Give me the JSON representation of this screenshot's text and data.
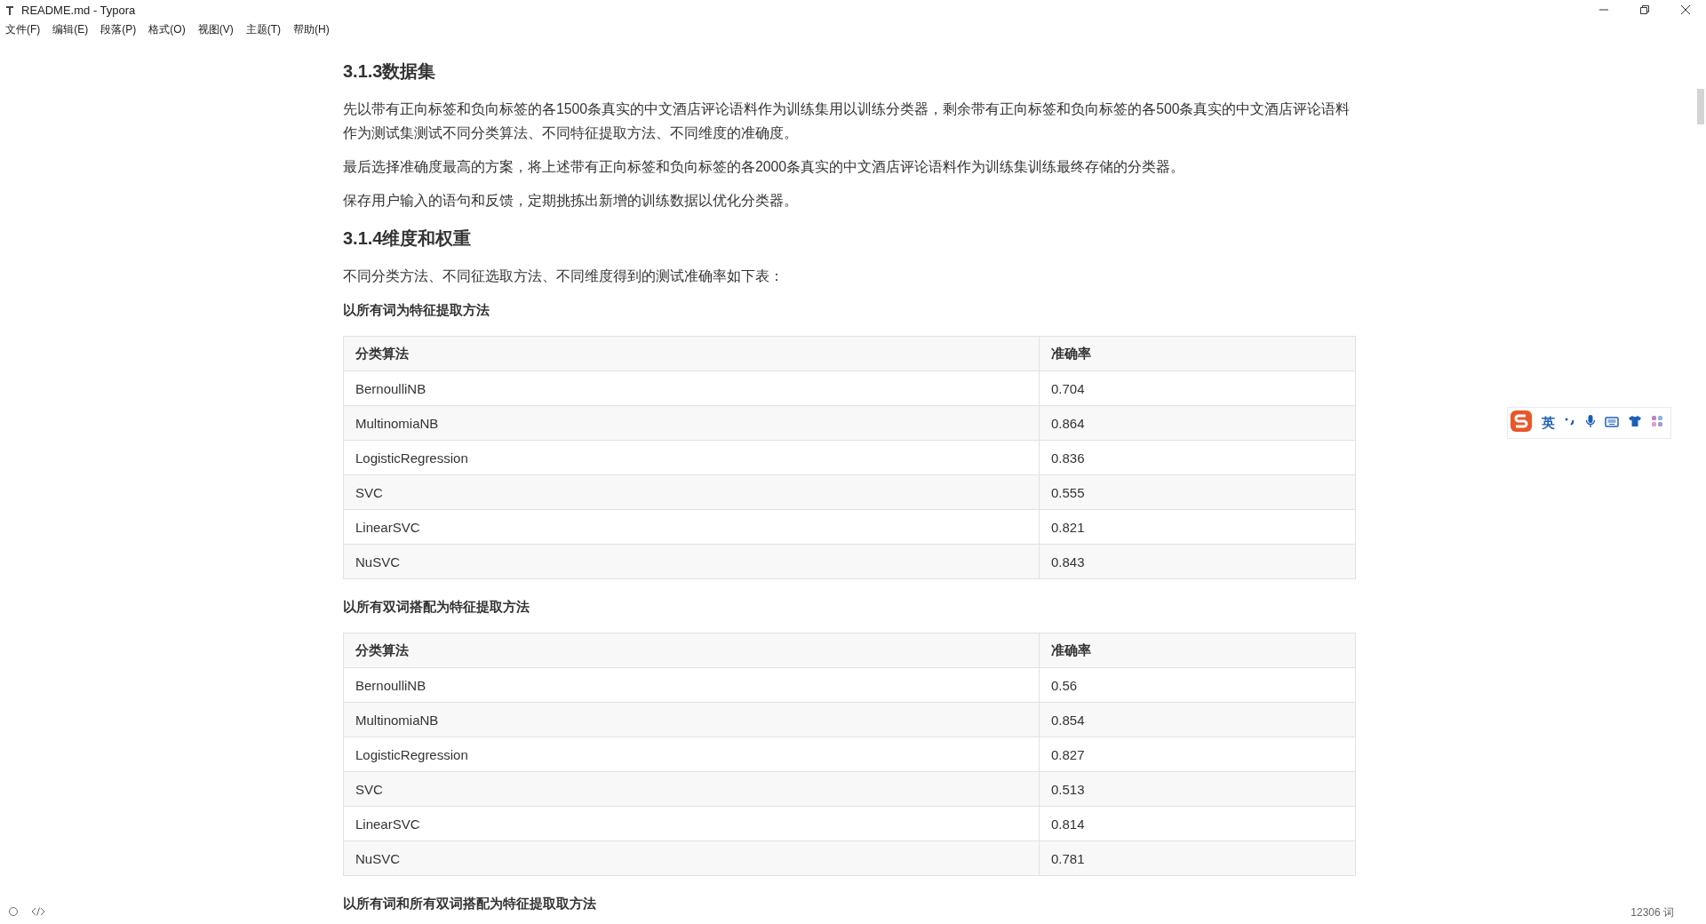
{
  "window": {
    "title": "README.md - Typora"
  },
  "menu": [
    "文件(F)",
    "编辑(E)",
    "段落(P)",
    "格式(O)",
    "视图(V)",
    "主题(T)",
    "帮助(H)"
  ],
  "document": [
    {
      "kind": "heading",
      "text": "3.1.3数据集"
    },
    {
      "kind": "paragraph",
      "text": "先以带有正向标签和负向标签的各1500条真实的中文酒店评论语料作为训练集用以训练分类器，剩余带有正向标签和负向标签的各500条真实的中文酒店评论语料作为测试集测试不同分类算法、不同特征提取方法、不同维度的准确度。"
    },
    {
      "kind": "paragraph",
      "text": "最后选择准确度最高的方案，将上述带有正向标签和负向标签的各2000条真实的中文酒店评论语料作为训练集训练最终存储的分类器。"
    },
    {
      "kind": "paragraph",
      "text": "保存用户输入的语句和反馈，定期挑拣出新增的训练数据以优化分类器。"
    },
    {
      "kind": "heading",
      "text": "3.1.4维度和权重"
    },
    {
      "kind": "paragraph",
      "text": "不同分类方法、不同征选取方法、不同维度得到的测试准确率如下表："
    },
    {
      "kind": "label",
      "text": "以所有词为特征提取方法"
    },
    {
      "kind": "table",
      "columns": [
        "分类算法",
        "准确率"
      ],
      "rows": [
        [
          "BernoulliNB",
          "0.704"
        ],
        [
          "MultinomiaNB",
          "0.864"
        ],
        [
          "LogisticRegression",
          "0.836"
        ],
        [
          "SVC",
          "0.555"
        ],
        [
          "LinearSVC",
          "0.821"
        ],
        [
          "NuSVC",
          "0.843"
        ]
      ]
    },
    {
      "kind": "label",
      "text": "以所有双词搭配为特征提取方法"
    },
    {
      "kind": "table",
      "columns": [
        "分类算法",
        "准确率"
      ],
      "rows": [
        [
          "BernoulliNB",
          "0.56"
        ],
        [
          "MultinomiaNB",
          "0.854"
        ],
        [
          "LogisticRegression",
          "0.827"
        ],
        [
          "SVC",
          "0.513"
        ],
        [
          "LinearSVC",
          "0.814"
        ],
        [
          "NuSVC",
          "0.781"
        ]
      ]
    },
    {
      "kind": "label",
      "text": "以所有词和所有双词搭配为特征提取取方法"
    }
  ],
  "ime_toolbar": {
    "mode": "英"
  },
  "status_bar": {
    "word_count": "12306 词"
  }
}
